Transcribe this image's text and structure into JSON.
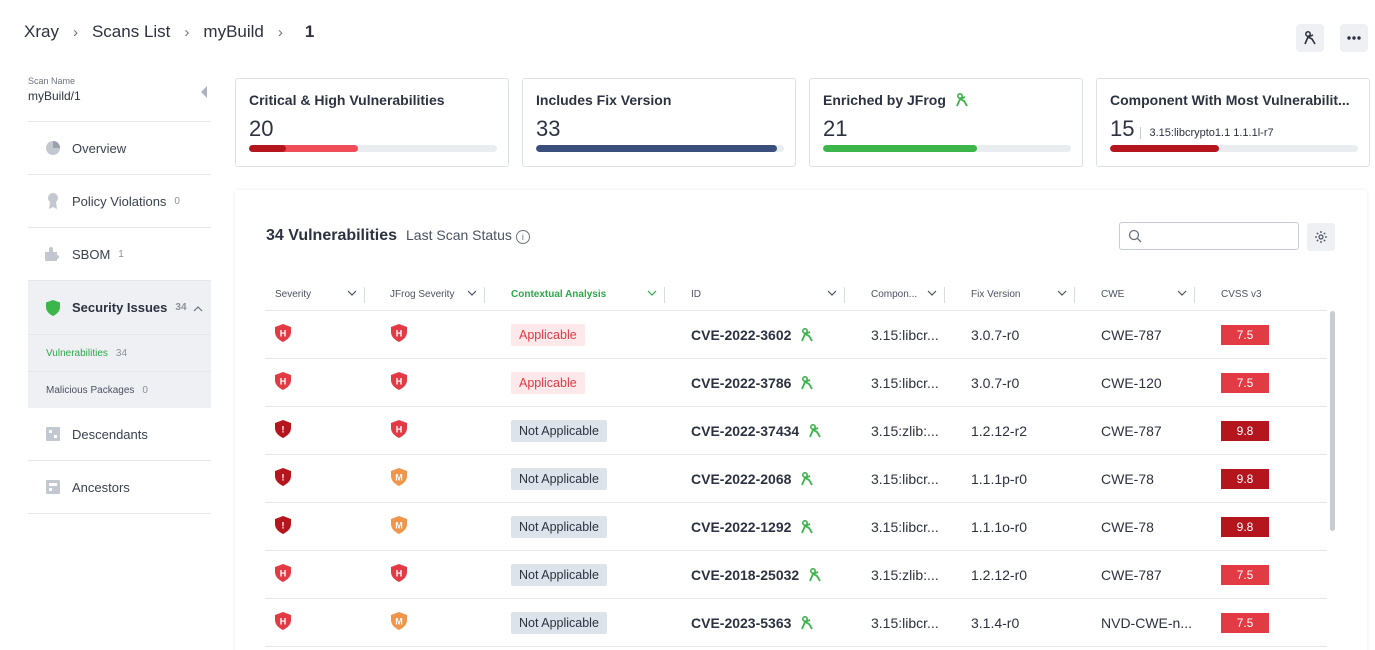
{
  "breadcrumb": {
    "items": [
      "Xray",
      "Scans List",
      "myBuild"
    ],
    "current": "1"
  },
  "sidebar": {
    "scan_name_label": "Scan Name",
    "scan_name_value": "myBuild/1",
    "items": [
      {
        "label": "Overview",
        "count": ""
      },
      {
        "label": "Policy Violations",
        "count": "0"
      },
      {
        "label": "SBOM",
        "count": "1"
      },
      {
        "label": "Security Issues",
        "count": "34"
      },
      {
        "label": "Descendants",
        "count": ""
      },
      {
        "label": "Ancestors",
        "count": ""
      }
    ],
    "sub_items": [
      {
        "label": "Vulnerabilities",
        "count": "34"
      },
      {
        "label": "Malicious Packages",
        "count": "0"
      }
    ]
  },
  "cards": [
    {
      "title": "Critical & High Vulnerabilities",
      "value": "20",
      "sub": ""
    },
    {
      "title": "Includes Fix Version",
      "value": "33",
      "sub": ""
    },
    {
      "title": "Enriched by JFrog",
      "value": "21",
      "sub": ""
    },
    {
      "title": "Component With Most Vulnerabilit...",
      "value": "15",
      "sub": "3.15:libcrypto1.1 1.1.1l-r7"
    }
  ],
  "card_bars": [
    {
      "segments": [
        {
          "fraction": 0.15,
          "color": "#b5161e"
        },
        {
          "fraction": 0.44,
          "color": "#ef4e59"
        }
      ]
    },
    {
      "segments": [
        {
          "fraction": 0.97,
          "color": "#3b4f7d"
        }
      ]
    },
    {
      "segments": [
        {
          "fraction": 0.62,
          "color": "#3cb54a"
        }
      ]
    },
    {
      "segments": [
        {
          "fraction": 0.44,
          "color": "#b5161e"
        }
      ]
    }
  ],
  "panel": {
    "title": "34 Vulnerabilities",
    "subtitle": "Last Scan Status",
    "search_placeholder": ""
  },
  "table": {
    "columns": [
      "Severity",
      "JFrog Severity",
      "Contextual Analysis",
      "ID",
      "Compon...",
      "Fix Version",
      "CWE",
      "CVSS v3"
    ],
    "rows": [
      {
        "severity": "high",
        "jfrog": "high",
        "ctx": "Applicable",
        "id": "CVE-2022-3602",
        "component": "3.15:libcr...",
        "fix": "3.0.7-r0",
        "cwe": "CWE-787",
        "cvss": "7.5"
      },
      {
        "severity": "high",
        "jfrog": "high",
        "ctx": "Applicable",
        "id": "CVE-2022-3786",
        "component": "3.15:libcr...",
        "fix": "3.0.7-r0",
        "cwe": "CWE-120",
        "cvss": "7.5"
      },
      {
        "severity": "critical",
        "jfrog": "high",
        "ctx": "Not Applicable",
        "id": "CVE-2022-37434",
        "component": "3.15:zlib:...",
        "fix": "1.2.12-r2",
        "cwe": "CWE-787",
        "cvss": "9.8"
      },
      {
        "severity": "critical",
        "jfrog": "medium",
        "ctx": "Not Applicable",
        "id": "CVE-2022-2068",
        "component": "3.15:libcr...",
        "fix": "1.1.1p-r0",
        "cwe": "CWE-78",
        "cvss": "9.8"
      },
      {
        "severity": "critical",
        "jfrog": "medium",
        "ctx": "Not Applicable",
        "id": "CVE-2022-1292",
        "component": "3.15:libcr...",
        "fix": "1.1.1o-r0",
        "cwe": "CWE-78",
        "cvss": "9.8"
      },
      {
        "severity": "high",
        "jfrog": "high",
        "ctx": "Not Applicable",
        "id": "CVE-2018-25032",
        "component": "3.15:zlib:...",
        "fix": "1.2.12-r0",
        "cwe": "CWE-787",
        "cvss": "7.5"
      },
      {
        "severity": "high",
        "jfrog": "medium",
        "ctx": "Not Applicable",
        "id": "CVE-2023-5363",
        "component": "3.15:libcr...",
        "fix": "3.1.4-r0",
        "cwe": "NVD-CWE-n...",
        "cvss": "7.5"
      }
    ]
  },
  "colors": {
    "high": "#e23b44",
    "critical": "#b5161e",
    "medium": "#f0954a",
    "jfrog_green": "#3cb54a",
    "cvss_high": "#e23b44",
    "cvss_critical": "#b5161e"
  }
}
